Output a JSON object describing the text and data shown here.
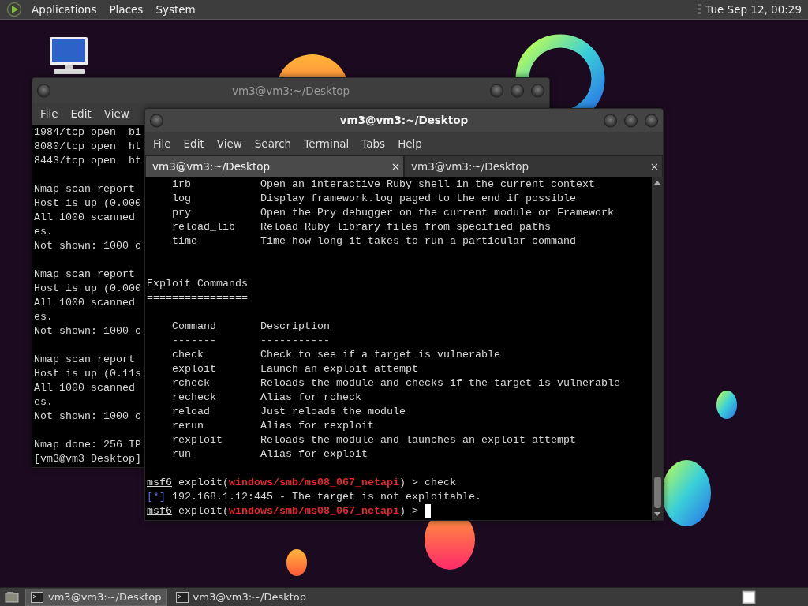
{
  "top_panel": {
    "menus": [
      "Applications",
      "Places",
      "System"
    ],
    "clock": "Tue Sep 12, 00:29"
  },
  "windows": [
    {
      "title": "vm3@vm3:~/Desktop",
      "active": false,
      "menus": [
        "File",
        "Edit",
        "View"
      ],
      "lines": [
        {
          "kind": "text",
          "text": "1984/tcp open  bi"
        },
        {
          "kind": "text",
          "text": "8080/tcp open  ht"
        },
        {
          "kind": "text",
          "text": "8443/tcp open  ht"
        },
        {
          "kind": "blank"
        },
        {
          "kind": "text",
          "text": "Nmap scan report"
        },
        {
          "kind": "text",
          "text": "Host is up (0.000"
        },
        {
          "kind": "text",
          "text": "All 1000 scanned"
        },
        {
          "kind": "text",
          "text": "es."
        },
        {
          "kind": "text",
          "text": "Not shown: 1000 c"
        },
        {
          "kind": "blank"
        },
        {
          "kind": "text",
          "text": "Nmap scan report"
        },
        {
          "kind": "text",
          "text": "Host is up (0.000"
        },
        {
          "kind": "text",
          "text": "All 1000 scanned"
        },
        {
          "kind": "text",
          "text": "es."
        },
        {
          "kind": "text",
          "text": "Not shown: 1000 c"
        },
        {
          "kind": "blank"
        },
        {
          "kind": "text",
          "text": "Nmap scan report"
        },
        {
          "kind": "text",
          "text": "Host is up (0.11s"
        },
        {
          "kind": "text",
          "text": "All 1000 scanned"
        },
        {
          "kind": "text",
          "text": "es."
        },
        {
          "kind": "text",
          "text": "Not shown: 1000 c"
        },
        {
          "kind": "blank"
        },
        {
          "kind": "text",
          "text": "Nmap done: 256 IP"
        },
        {
          "kind": "text",
          "text": "[vm3@vm3 Desktop]"
        }
      ]
    },
    {
      "title": "vm3@vm3:~/Desktop",
      "active": true,
      "menus": [
        "File",
        "Edit",
        "View",
        "Search",
        "Terminal",
        "Tabs",
        "Help"
      ],
      "tabs": [
        {
          "label": "vm3@vm3:~/Desktop",
          "selected": true,
          "close": "×"
        },
        {
          "label": "vm3@vm3:~/Desktop",
          "selected": false,
          "close": "×"
        }
      ],
      "lines": [
        {
          "kind": "row",
          "command": "irb",
          "description": "Open an interactive Ruby shell in the current context"
        },
        {
          "kind": "row",
          "command": "log",
          "description": "Display framework.log paged to the end if possible"
        },
        {
          "kind": "row",
          "command": "pry",
          "description": "Open the Pry debugger on the current module or Framework"
        },
        {
          "kind": "row",
          "command": "reload_lib",
          "description": "Reload Ruby library files from specified paths"
        },
        {
          "kind": "row",
          "command": "time",
          "description": "Time how long it takes to run a particular command"
        },
        {
          "kind": "blank"
        },
        {
          "kind": "blank"
        },
        {
          "kind": "text",
          "text": "Exploit Commands"
        },
        {
          "kind": "text",
          "text": "================"
        },
        {
          "kind": "blank"
        },
        {
          "kind": "row",
          "command": "Command",
          "description": "Description"
        },
        {
          "kind": "row",
          "command": "-------",
          "description": "-----------"
        },
        {
          "kind": "row",
          "command": "check",
          "description": "Check to see if a target is vulnerable"
        },
        {
          "kind": "row",
          "command": "exploit",
          "description": "Launch an exploit attempt"
        },
        {
          "kind": "row",
          "command": "rcheck",
          "description": "Reloads the module and checks if the target is vulnerable"
        },
        {
          "kind": "row",
          "command": "recheck",
          "description": "Alias for rcheck"
        },
        {
          "kind": "row",
          "command": "reload",
          "description": "Just reloads the module"
        },
        {
          "kind": "row",
          "command": "rerun",
          "description": "Alias for rexploit"
        },
        {
          "kind": "row",
          "command": "rexploit",
          "description": "Reloads the module and launches an exploit attempt"
        },
        {
          "kind": "row",
          "command": "run",
          "description": "Alias for exploit"
        },
        {
          "kind": "blank"
        },
        {
          "kind": "prompt",
          "prefix": "msf6",
          "context": "exploit(",
          "module": "windows/smb/ms08_067_netapi",
          "suffix": ") >",
          "command": "check",
          "cursor": false
        },
        {
          "kind": "status",
          "marker": "[*]",
          "text": "192.168.1.12:445 - The target is not exploitable."
        },
        {
          "kind": "prompt",
          "prefix": "msf6",
          "context": "exploit(",
          "module": "windows/smb/ms08_067_netapi",
          "suffix": ") >",
          "cursor": true
        }
      ]
    }
  ],
  "taskbar": [
    {
      "label": "vm3@vm3:~/Desktop",
      "selected": true
    },
    {
      "label": "vm3@vm3:~/Desktop",
      "selected": false
    }
  ]
}
